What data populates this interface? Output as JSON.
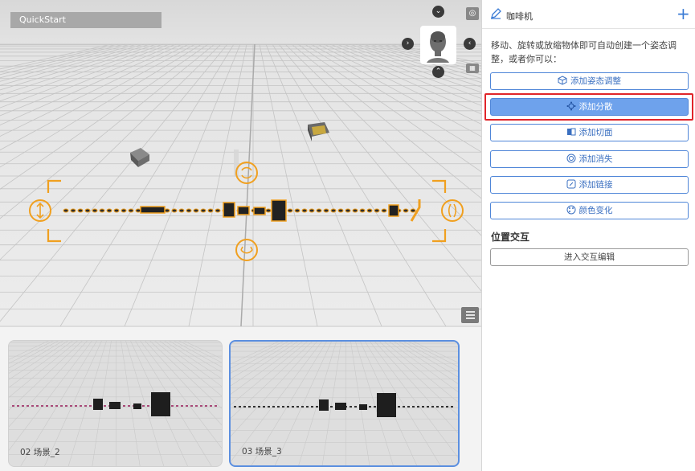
{
  "viewport": {
    "tab_label": "QuickStart"
  },
  "thumbnails": [
    {
      "label": "02  场景_2",
      "selected": false
    },
    {
      "label": "03  场景_3",
      "selected": true
    }
  ],
  "panel": {
    "object_name": "咖啡机",
    "description": "移动、旋转或放缩物体即可自动创建一个姿态调整，或者你可以：",
    "actions": [
      {
        "label": "添加姿态调整",
        "icon": "cube-icon"
      },
      {
        "label": "添加分散",
        "icon": "scatter-icon",
        "active": true
      },
      {
        "label": "添加切面",
        "icon": "cut-plane-icon"
      },
      {
        "label": "添加消失",
        "icon": "fade-icon"
      },
      {
        "label": "添加链接",
        "icon": "link-icon"
      },
      {
        "label": "颜色变化",
        "icon": "palette-icon"
      }
    ],
    "section_title": "位置交互",
    "enter_button": "进入交互编辑"
  },
  "colors": {
    "accent": "#4f86d8",
    "active_fill": "#6ea2ec",
    "highlight": "#e0252a",
    "gizmo": "#f0a020"
  }
}
